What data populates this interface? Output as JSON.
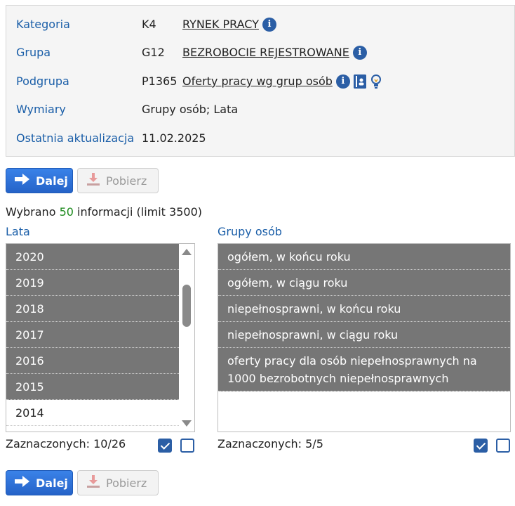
{
  "info": {
    "rows": [
      {
        "label": "Kategoria",
        "code": "K4",
        "value": "RYNEK PRACY"
      },
      {
        "label": "Grupa",
        "code": "G12",
        "value": "BEZROBOCIE REJESTROWANE"
      },
      {
        "label": "Podgrupa",
        "code": "P1365",
        "value": "Oferty pracy wg grup osób"
      },
      {
        "label": "Wymiary",
        "code": "",
        "value": "Grupy osób; Lata"
      },
      {
        "label": "Ostatnia aktualizacja",
        "code": "",
        "value": "11.02.2025"
      }
    ]
  },
  "buttons": {
    "next": "Dalej",
    "download": "Pobierz"
  },
  "selection": {
    "prefix": "Wybrano",
    "count": "50",
    "suffix": "informacji (limit 3500)"
  },
  "years": {
    "title": "Lata",
    "items": [
      "2020",
      "2019",
      "2018",
      "2017",
      "2016",
      "2015",
      "2014"
    ],
    "selected_count": "Zaznaczonych: 10/26"
  },
  "groups": {
    "title": "Grupy osób",
    "items": [
      "ogółem, w końcu roku",
      "ogółem, w ciągu roku",
      "niepełnosprawni, w końcu roku",
      "niepełnosprawni, w ciągu roku",
      "oferty pracy dla osób niepełnosprawnych na 1000 bezrobotnych niepełnosprawnych"
    ],
    "selected_count": "Zaznaczonych: 5/5"
  },
  "colors": {
    "accent": "#2b6fd6",
    "label": "#1a5ea8",
    "selected": "#767676",
    "count": "#1d8a1d"
  },
  "icons": [
    "info-icon",
    "book-icon",
    "bulb-icon",
    "arrow-right-icon",
    "download-icon"
  ]
}
